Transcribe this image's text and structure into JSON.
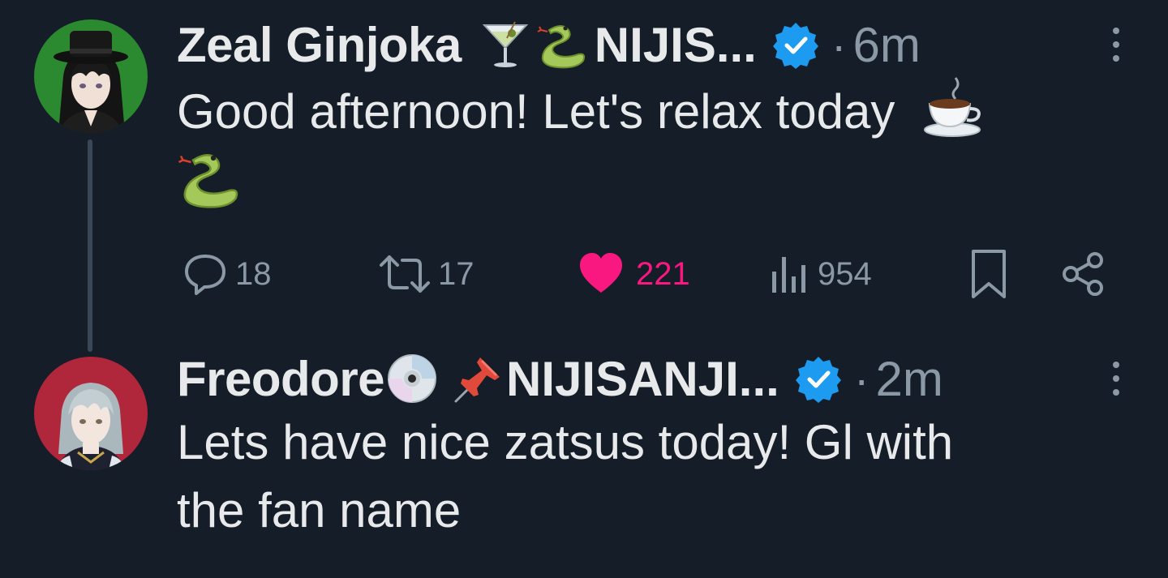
{
  "tweets": [
    {
      "author_name": "Zeal Ginjoka",
      "name_emojis": [
        "cocktail-glass",
        "snake"
      ],
      "handle_name": "NIJIS...",
      "verified": true,
      "separator": "·",
      "time": "6m",
      "text_line1": "Good afternoon! Let's relax today",
      "text_emojis": [
        "hot-beverage",
        "snake"
      ],
      "stats": {
        "replies": "18",
        "retweets": "17",
        "likes": "221",
        "views": "954"
      },
      "liked": true,
      "avatar_bg": "#2b8a2f"
    },
    {
      "author_name": "Freodore",
      "name_emojis": [
        "dvd",
        "pushpin"
      ],
      "handle_name": "NIJISANJI...",
      "verified": true,
      "separator": "·",
      "time": "2m",
      "text_line1": "Lets have nice zatsus today! Gl with",
      "text_line2": "the fan name",
      "avatar_bg": "#b0263b"
    }
  ],
  "colors": {
    "background": "#151d28",
    "text": "#e7e9ea",
    "muted": "#8b98a5",
    "like": "#f91880",
    "verified": "#1d9bf0",
    "thread_line": "#3a4756"
  }
}
